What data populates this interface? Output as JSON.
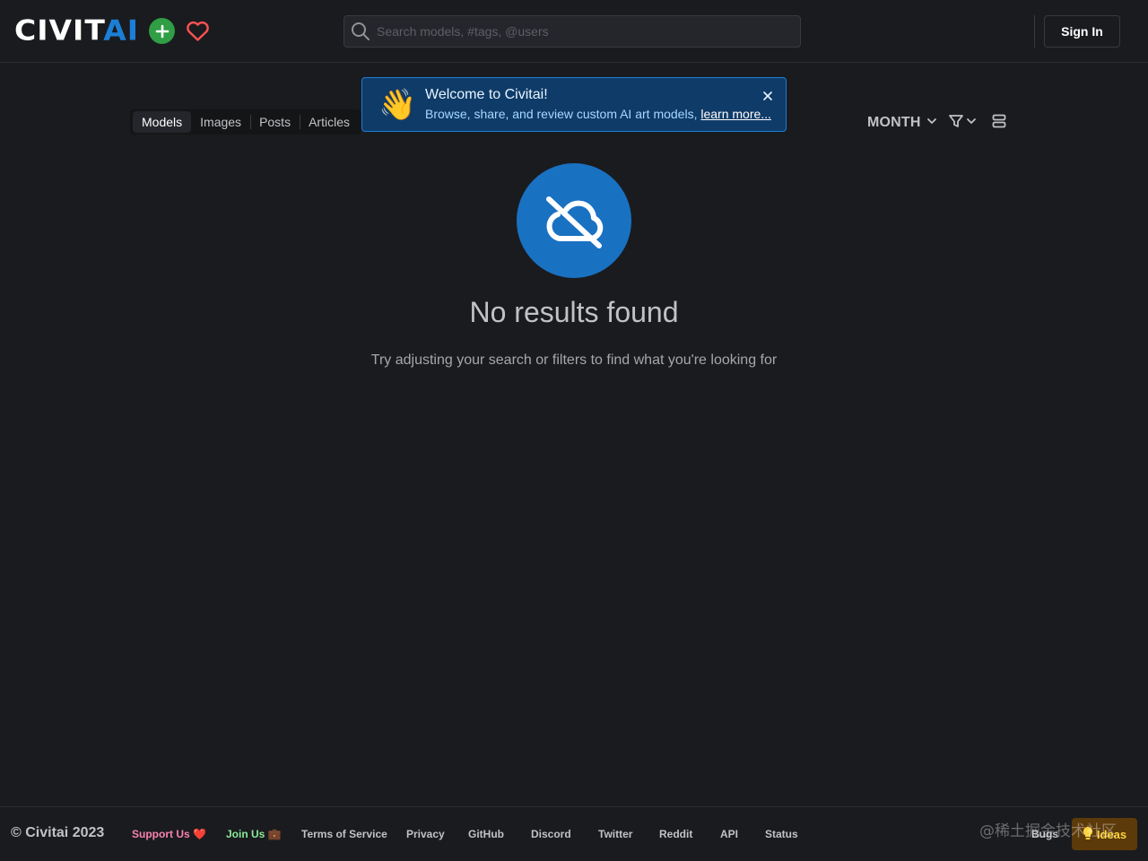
{
  "header": {
    "logo": {
      "main": "CIVIT",
      "accent": "AI"
    },
    "search_placeholder": "Search models, #tags, @users",
    "sign_in_label": "Sign In"
  },
  "toolbar": {
    "tabs": [
      {
        "label": "Models",
        "active": true
      },
      {
        "label": "Images",
        "active": false
      },
      {
        "label": "Posts",
        "active": false
      },
      {
        "label": "Articles",
        "active": false
      }
    ],
    "period_label": "MONTH"
  },
  "alert": {
    "emoji": "👋",
    "title": "Welcome to Civitai!",
    "body": "Browse, share, and review custom AI art models,",
    "link_label": "learn more...",
    "close_glyph": "×"
  },
  "empty_state": {
    "title": "No results found",
    "subtitle": "Try adjusting your search or filters to find what you're looking for"
  },
  "footer": {
    "copyright": "© Civitai 2023",
    "links": [
      {
        "label": "Support Us ❤️"
      },
      {
        "label": "Join Us 💼"
      },
      {
        "label": "Terms of Service"
      },
      {
        "label": "Privacy"
      },
      {
        "label": "GitHub"
      },
      {
        "label": "Discord"
      },
      {
        "label": "Twitter"
      },
      {
        "label": "Reddit"
      },
      {
        "label": "API"
      },
      {
        "label": "Status"
      }
    ],
    "bugs_label": "Bugs",
    "ideas_label": "Ideas",
    "watermark": "@稀土掘金技术社区"
  },
  "colors": {
    "background": "#1a1b1e",
    "accent_blue": "#1c7ed6",
    "add_green": "#2f9e44",
    "heart_red": "#fa5252",
    "alert_bg": "#0f3b68",
    "support_pink": "#f783ac",
    "join_green": "#8ce99a",
    "ideas_yellow": "#ffd43b"
  },
  "icons": {
    "add": "plus-circle-icon",
    "heart": "heart-icon",
    "search": "search-icon",
    "period": "chevron-down-icon",
    "filter": "filter-icon",
    "layout": "layout-rows-icon",
    "empty": "cloud-off-icon",
    "close": "close-icon",
    "ideas": "lightbulb-icon"
  }
}
